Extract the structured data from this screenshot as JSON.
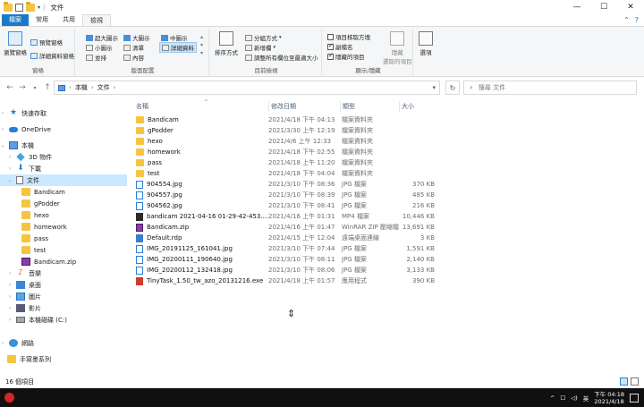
{
  "window": {
    "title": "文件",
    "controls": {
      "minimize": "—",
      "maximize": "☐",
      "close": "✕"
    }
  },
  "ribbon_tabs": [
    "檔案",
    "常用",
    "共用",
    "檢視"
  ],
  "ribbon": {
    "panes": {
      "navigation_pane": "瀏覽窗格",
      "preview_pane": "預覽窗格",
      "details_pane": "詳細資料窗格",
      "label": "窗格"
    },
    "layout": {
      "extra_large": "超大圖示",
      "large": "大圖示",
      "medium": "中圖示",
      "small": "小圖示",
      "list": "清單",
      "details": "詳細資料",
      "tiles": "並排",
      "content": "內容",
      "label": "版面配置"
    },
    "current_view": {
      "sort_by": "排序方式",
      "group_by": "分組方式",
      "add_columns": "新增欄",
      "size_all_columns": "調整所有欄位至最適大小",
      "label": "目前檢視"
    },
    "show_hide": {
      "item_checkboxes": "項目核取方塊",
      "file_extensions": "副檔名",
      "hidden_items": "隱藏的項目",
      "hide_selected": "隱藏",
      "hide_selected_2": "選取的項目",
      "label": "顯示/隱藏",
      "item_checkboxes_checked": false,
      "file_extensions_checked": true,
      "hidden_items_checked": true
    },
    "options": "選項"
  },
  "address": {
    "segments": [
      "本機",
      "文件"
    ],
    "search_placeholder": "搜尋 文件"
  },
  "nav_pane": [
    {
      "label": "快速存取",
      "icon": "star-icon"
    },
    {
      "label": "OneDrive",
      "icon": "cloud-icon"
    },
    {
      "label": "本機",
      "icon": "pc-icon"
    },
    {
      "label": "3D 物件",
      "icon": "cube-icon"
    },
    {
      "label": "下載",
      "icon": "download-icon"
    },
    {
      "label": "文件",
      "icon": "document-icon",
      "selected": true
    },
    {
      "label": "Bandicam",
      "icon": "folder-icon"
    },
    {
      "label": "gPodder",
      "icon": "folder-icon"
    },
    {
      "label": "hexo",
      "icon": "folder-icon"
    },
    {
      "label": "homework",
      "icon": "folder-icon"
    },
    {
      "label": "pass",
      "icon": "folder-icon"
    },
    {
      "label": "test",
      "icon": "folder-icon"
    },
    {
      "label": "Bandicam.zip",
      "icon": "zip-icon"
    },
    {
      "label": "音樂",
      "icon": "music-icon"
    },
    {
      "label": "桌面",
      "icon": "desktop-icon"
    },
    {
      "label": "圖片",
      "icon": "picture-icon"
    },
    {
      "label": "影片",
      "icon": "video-icon"
    },
    {
      "label": "本機磁碟 (C:)",
      "icon": "drive-icon"
    },
    {
      "label": "網路",
      "icon": "network-icon"
    },
    {
      "label": "手寫墨系列",
      "icon": "folder-icon"
    }
  ],
  "columns": {
    "name": "名稱",
    "date": "修改日期",
    "type": "類型",
    "size": "大小"
  },
  "files": [
    {
      "name": "Bandicam",
      "date": "2021/4/18 下午 04:13",
      "type": "檔案資料夾",
      "size": "",
      "icon": "folder"
    },
    {
      "name": "gPodder",
      "date": "2021/3/30 上午 12:19",
      "type": "檔案資料夾",
      "size": "",
      "icon": "folder"
    },
    {
      "name": "hexo",
      "date": "2021/4/6 上午 12:33",
      "type": "檔案資料夾",
      "size": "",
      "icon": "folder"
    },
    {
      "name": "homework",
      "date": "2021/4/18 下午 02:55",
      "type": "檔案資料夾",
      "size": "",
      "icon": "folder"
    },
    {
      "name": "pass",
      "date": "2021/4/18 上午 11:20",
      "type": "檔案資料夾",
      "size": "",
      "icon": "folder"
    },
    {
      "name": "test",
      "date": "2021/4/18 下午 04:04",
      "type": "檔案資料夾",
      "size": "",
      "icon": "folder"
    },
    {
      "name": "904554.jpg",
      "date": "2021/3/10 下午 08:36",
      "type": "JPG 檔案",
      "size": "370 KB",
      "icon": "jpg"
    },
    {
      "name": "904557.jpg",
      "date": "2021/3/10 下午 08:39",
      "type": "JPG 檔案",
      "size": "485 KB",
      "icon": "jpg"
    },
    {
      "name": "904562.jpg",
      "date": "2021/3/10 下午 08:41",
      "type": "JPG 檔案",
      "size": "216 KB",
      "icon": "jpg"
    },
    {
      "name": "bandicam 2021-04-16 01-29-42-453....",
      "date": "2021/4/16 上午 01:31",
      "type": "MP4 檔案",
      "size": "10,446 KB",
      "icon": "mp4"
    },
    {
      "name": "Bandicam.zip",
      "date": "2021/4/16 上午 01:47",
      "type": "WinRAR ZIP 壓縮檔",
      "size": "13,691 KB",
      "icon": "zip"
    },
    {
      "name": "Default.rdp",
      "date": "2021/4/15 上午 12:04",
      "type": "遠端桌面連線",
      "size": "3 KB",
      "icon": "rdp"
    },
    {
      "name": "IMG_20191125_161041.jpg",
      "date": "2021/3/10 下午 07:44",
      "type": "JPG 檔案",
      "size": "1,591 KB",
      "icon": "jpg"
    },
    {
      "name": "IMG_20200111_190640.jpg",
      "date": "2021/3/10 下午 08:11",
      "type": "JPG 檔案",
      "size": "2,140 KB",
      "icon": "jpg"
    },
    {
      "name": "IMG_20200112_132418.jpg",
      "date": "2021/3/10 下午 08:06",
      "type": "JPG 檔案",
      "size": "3,133 KB",
      "icon": "jpg"
    },
    {
      "name": "TinyTask_1.50_tw_azo_20131216.exe",
      "date": "2021/4/18 上午 01:57",
      "type": "應用程式",
      "size": "390 KB",
      "icon": "exe"
    }
  ],
  "status": {
    "item_count": "16 個項目"
  },
  "taskbar": {
    "tray_up": "^",
    "tray_net": "☐",
    "tray_sound": "◁)",
    "ime": "英",
    "time": "下午 04:18",
    "date": "2021/4/18"
  },
  "colors": {
    "accent": "#1979ca",
    "selection": "#cce8ff",
    "folder": "#f5c542",
    "taskbar": "#101010"
  }
}
